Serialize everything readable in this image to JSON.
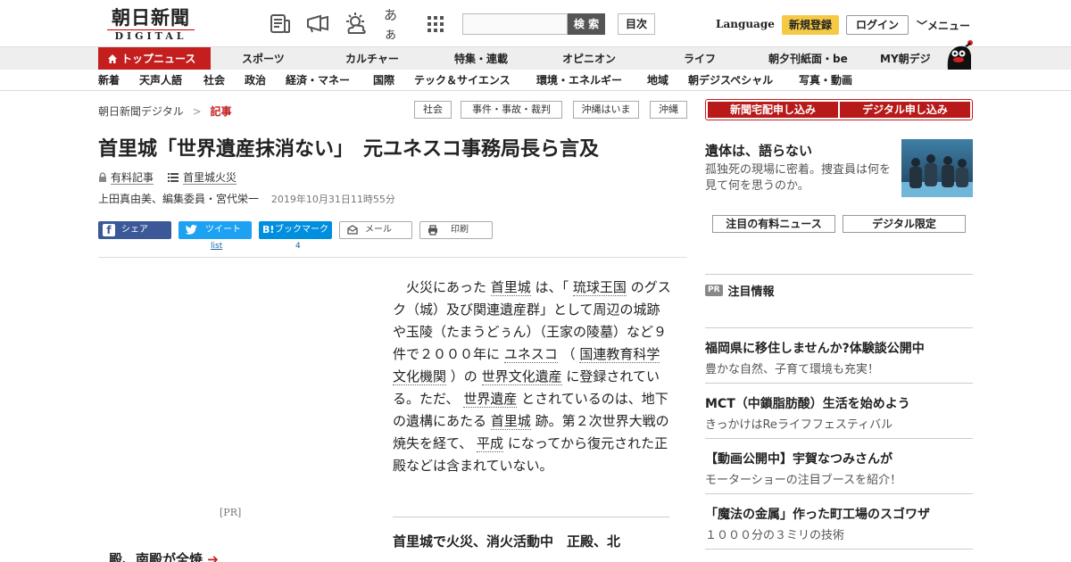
{
  "header": {
    "logo_kanji": "朝日新聞",
    "logo_digital": "DIGITAL",
    "font_toggle_label": "あぁ",
    "search_button": "検 索",
    "toc_button": "目次",
    "language_label": "Language",
    "register_button": "新規登録",
    "login_button": "ログイン",
    "menu_button": "メニュー"
  },
  "nav_primary": [
    {
      "label": "トップニュース"
    },
    {
      "label": "スポーツ"
    },
    {
      "label": "カルチャー"
    },
    {
      "label": "特集・連載"
    },
    {
      "label": "オピニオン"
    },
    {
      "label": "ライフ"
    },
    {
      "label": "朝夕刊紙面・be"
    },
    {
      "label": "MY朝デジ"
    }
  ],
  "nav_secondary": [
    {
      "label": "新着"
    },
    {
      "label": "天声人語"
    },
    {
      "label": "社会"
    },
    {
      "label": "政治"
    },
    {
      "label": "経済・マネー"
    },
    {
      "label": "国際"
    },
    {
      "label": "テック＆サイエンス"
    },
    {
      "label": "環境・エネルギー"
    },
    {
      "label": "地域"
    },
    {
      "label": "朝デジスペシャル"
    },
    {
      "label": "写真・動画"
    }
  ],
  "breadcrumb": {
    "home": "朝日新聞デジタル",
    "separator": ">",
    "current": "記事"
  },
  "tags": [
    "社会",
    "事件・事故・裁判",
    "沖縄はいま",
    "沖縄"
  ],
  "subscribe": {
    "paper": "新聞宅配申し込み",
    "digital": "デジタル申し込み"
  },
  "article": {
    "title": "首里城「世界遺産抹消ない」　元ユネスコ事務局長ら言及",
    "paid_label": "有料記事",
    "series_label": "首里城火災",
    "authors": "上田真由美、編集委員・宮代栄一",
    "date": "2019年10月31日11時55分",
    "body_parts": {
      "p1": "火災にあった",
      "l1": "首里城",
      "p2": "は、「",
      "l2": "琉球王国",
      "p3": "のグスク（城）及び関連遺産群」として周辺の城跡や玉陵（たまうどぅん）（王家の陵墓）など９件で２０００年に",
      "l3": "ユネスコ",
      "p4": "（",
      "l4": "国連教育科学文化機関",
      "p5": "）の",
      "l5": "世界文化遺産",
      "p6": "に登録されている。ただ、",
      "l6": "世界遺産",
      "p7": "とされているのは、地下の遺構にあたる",
      "l7": "首里城",
      "p8": "跡。第２次世界大戦の焼失を経て、",
      "l8": "平成",
      "p9": "になってから復元された正殿などは含まれていない。"
    },
    "related_title": "首里城で火災、消火活動中　正殿、北",
    "cut_text": "殿、南殿が全焼",
    "pr_label": "[PR]"
  },
  "share": {
    "facebook": "シェア",
    "twitter": "ツイート",
    "twitter_count": "list",
    "hatena": "ブックマーク",
    "hatena_count": "4",
    "mail": "メール",
    "print": "印刷"
  },
  "sidebar": {
    "promo_title": "遺体は、語らない",
    "promo_desc": "孤独死の現場に密着。捜査員は何を見て何を思うのか。",
    "btn_paid_news": "注目の有料ニュース",
    "btn_digital_only": "デジタル限定",
    "pr_badge": "PR",
    "pr_heading": "注目情報",
    "ads": [
      {
        "title": "福岡県に移住しませんか?体験談公開中",
        "desc": "豊かな自然、子育て環境も充実！"
      },
      {
        "title": "MCT（中鎖脂肪酸）生活を始めよう",
        "desc": "きっかけはReライフフェスティバル"
      },
      {
        "title": "【動画公開中】宇賀なつみさんが",
        "desc": "モーターショーの注目ブースを紹介！"
      },
      {
        "title": "「魔法の金属」作った町工場のスゴワザ",
        "desc": "１０００分の３ミリの技術"
      }
    ]
  },
  "colors": {
    "brand_red": "#c41e1e",
    "register_yellow": "#f6c945",
    "facebook": "#3b5998",
    "twitter": "#1da1f2",
    "hatena": "#008fde"
  }
}
